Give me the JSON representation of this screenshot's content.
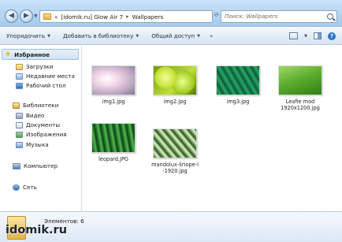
{
  "address": {
    "crumbs": [
      "«",
      "[idomik.ru] Glow Air 7",
      "Wallpapers"
    ],
    "search_placeholder": "Поиск: Wallpapers"
  },
  "toolbar": {
    "organize": "Упорядочить",
    "add_to_library": "Добавить в библиотеку",
    "share": "Общий доступ",
    "more": "»"
  },
  "sidebar": {
    "favorites": "Избранное",
    "favorites_items": [
      "Загрузки",
      "Недавние места",
      "Рабочий стол"
    ],
    "libraries": "Библиотеки",
    "libraries_items": [
      "Видео",
      "Документы",
      "Изображения",
      "Музыка"
    ],
    "computer": "Компьютер",
    "network": "Сеть"
  },
  "files": [
    {
      "name": "img1.jpg",
      "thumb": "pink-flower"
    },
    {
      "name": "img2.jpg",
      "thumb": "green-drops"
    },
    {
      "name": "img3.jpg",
      "thumb": "green-leaves"
    },
    {
      "name": "Leafie mod\n1920x1200.jpg",
      "thumb": "green-leaf"
    },
    {
      "name": "leopard.JPG",
      "thumb": "green-grass"
    },
    {
      "name": "mandolux-liriope-l\n-1920.jpg",
      "thumb": "striped-leaves"
    }
  ],
  "details": {
    "count": "Элементов: 6"
  },
  "watermark": "idomik.ru"
}
